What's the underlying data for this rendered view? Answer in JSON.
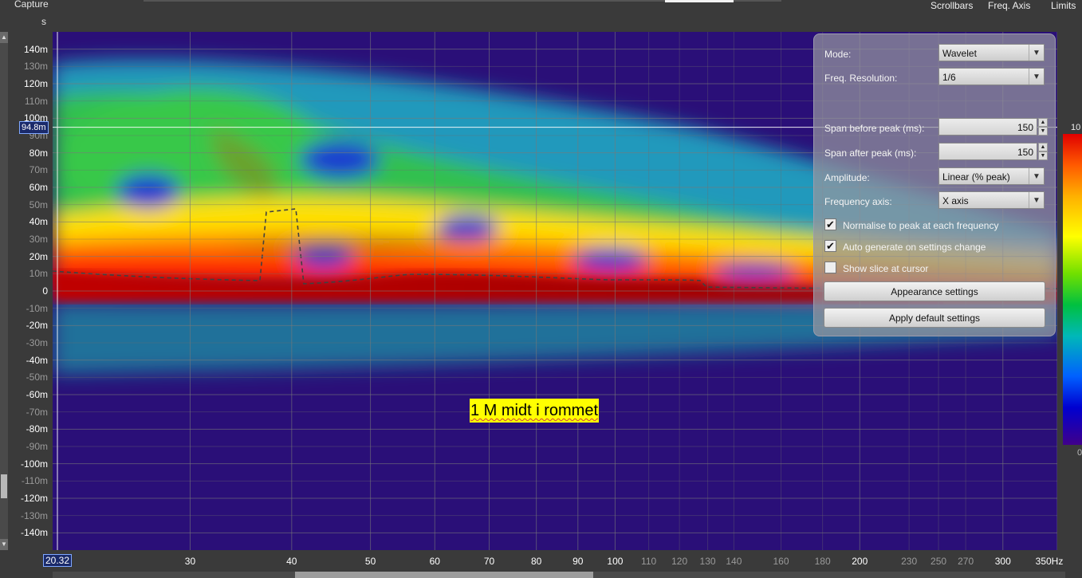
{
  "topbar": {
    "capture_label": "Capture",
    "units_label": "s",
    "buttons": [
      "Scrollbars",
      "Freq. Axis",
      "Limits"
    ]
  },
  "yaxis": {
    "ticks": [
      {
        "label": "140m",
        "v": 140,
        "major": true
      },
      {
        "label": "130m",
        "v": 130,
        "major": false
      },
      {
        "label": "120m",
        "v": 120,
        "major": true
      },
      {
        "label": "110m",
        "v": 110,
        "major": false
      },
      {
        "label": "100m",
        "v": 100,
        "major": true
      },
      {
        "label": "90m",
        "v": 90,
        "major": false
      },
      {
        "label": "80m",
        "v": 80,
        "major": true
      },
      {
        "label": "70m",
        "v": 70,
        "major": false
      },
      {
        "label": "60m",
        "v": 60,
        "major": true
      },
      {
        "label": "50m",
        "v": 50,
        "major": false
      },
      {
        "label": "40m",
        "v": 40,
        "major": true
      },
      {
        "label": "30m",
        "v": 30,
        "major": false
      },
      {
        "label": "20m",
        "v": 20,
        "major": true
      },
      {
        "label": "10m",
        "v": 10,
        "major": false
      },
      {
        "label": "0",
        "v": 0,
        "major": true
      },
      {
        "label": "-10m",
        "v": -10,
        "major": false
      },
      {
        "label": "-20m",
        "v": -20,
        "major": true
      },
      {
        "label": "-30m",
        "v": -30,
        "major": false
      },
      {
        "label": "-40m",
        "v": -40,
        "major": true
      },
      {
        "label": "-50m",
        "v": -50,
        "major": false
      },
      {
        "label": "-60m",
        "v": -60,
        "major": true
      },
      {
        "label": "-70m",
        "v": -70,
        "major": false
      },
      {
        "label": "-80m",
        "v": -80,
        "major": true
      },
      {
        "label": "-90m",
        "v": -90,
        "major": false
      },
      {
        "label": "-100m",
        "v": -100,
        "major": true
      },
      {
        "label": "-110m",
        "v": -110,
        "major": false
      },
      {
        "label": "-120m",
        "v": -120,
        "major": true
      },
      {
        "label": "-130m",
        "v": -130,
        "major": false
      },
      {
        "label": "-140m",
        "v": -140,
        "major": true
      }
    ],
    "cursor_value": "94.8m",
    "cursor_v": 94.8,
    "range": [
      -150,
      150
    ]
  },
  "xaxis": {
    "cursor_value": "20.32",
    "range": [
      20.32,
      350
    ],
    "scale": "log",
    "unit": "Hz",
    "ticks": [
      {
        "label": "30",
        "v": 30,
        "major": true
      },
      {
        "label": "40",
        "v": 40,
        "major": true
      },
      {
        "label": "50",
        "v": 50,
        "major": true
      },
      {
        "label": "60",
        "v": 60,
        "major": true
      },
      {
        "label": "70",
        "v": 70,
        "major": true
      },
      {
        "label": "80",
        "v": 80,
        "major": true
      },
      {
        "label": "90",
        "v": 90,
        "major": true
      },
      {
        "label": "100",
        "v": 100,
        "major": true
      },
      {
        "label": "110",
        "v": 110,
        "major": false
      },
      {
        "label": "120",
        "v": 120,
        "major": false
      },
      {
        "label": "130",
        "v": 130,
        "major": false
      },
      {
        "label": "140",
        "v": 140,
        "major": false
      },
      {
        "label": "160",
        "v": 160,
        "major": false
      },
      {
        "label": "180",
        "v": 180,
        "major": false
      },
      {
        "label": "200",
        "v": 200,
        "major": true
      },
      {
        "label": "230",
        "v": 230,
        "major": false
      },
      {
        "label": "250",
        "v": 250,
        "major": false
      },
      {
        "label": "270",
        "v": 270,
        "major": false
      },
      {
        "label": "300",
        "v": 300,
        "major": true
      },
      {
        "label": "350Hz",
        "v": 350,
        "major": true
      }
    ]
  },
  "panel": {
    "mode_label": "Mode:",
    "mode_value": "Wavelet",
    "freq_res_label": "Freq. Resolution:",
    "freq_res_value": "1/6",
    "span_before_label": "Span before peak (ms):",
    "span_before_value": "150",
    "span_after_label": "Span after peak (ms):",
    "span_after_value": "150",
    "amplitude_label": "Amplitude:",
    "amplitude_value": "Linear (% peak)",
    "freq_axis_label": "Frequency axis:",
    "freq_axis_value": "X axis",
    "normalise_label": "Normalise to peak at each frequency",
    "normalise_checked": true,
    "autogen_label": "Auto generate on settings change",
    "autogen_checked": true,
    "slice_label": "Show slice at cursor",
    "slice_checked": false,
    "appearance_button": "Appearance settings",
    "defaults_button": "Apply default settings"
  },
  "colorbar": {
    "top_label": "10",
    "bottom_label": "0"
  },
  "annotation": {
    "text": "1 M midt i rommet"
  },
  "colors": {
    "plot_background": "#2a0f78",
    "peak_band": "#a00000",
    "hot": "#ff3000",
    "warm": "#ffd000",
    "mid": "#40c840",
    "cool": "#20b0c8",
    "cold": "#1830c8"
  }
}
